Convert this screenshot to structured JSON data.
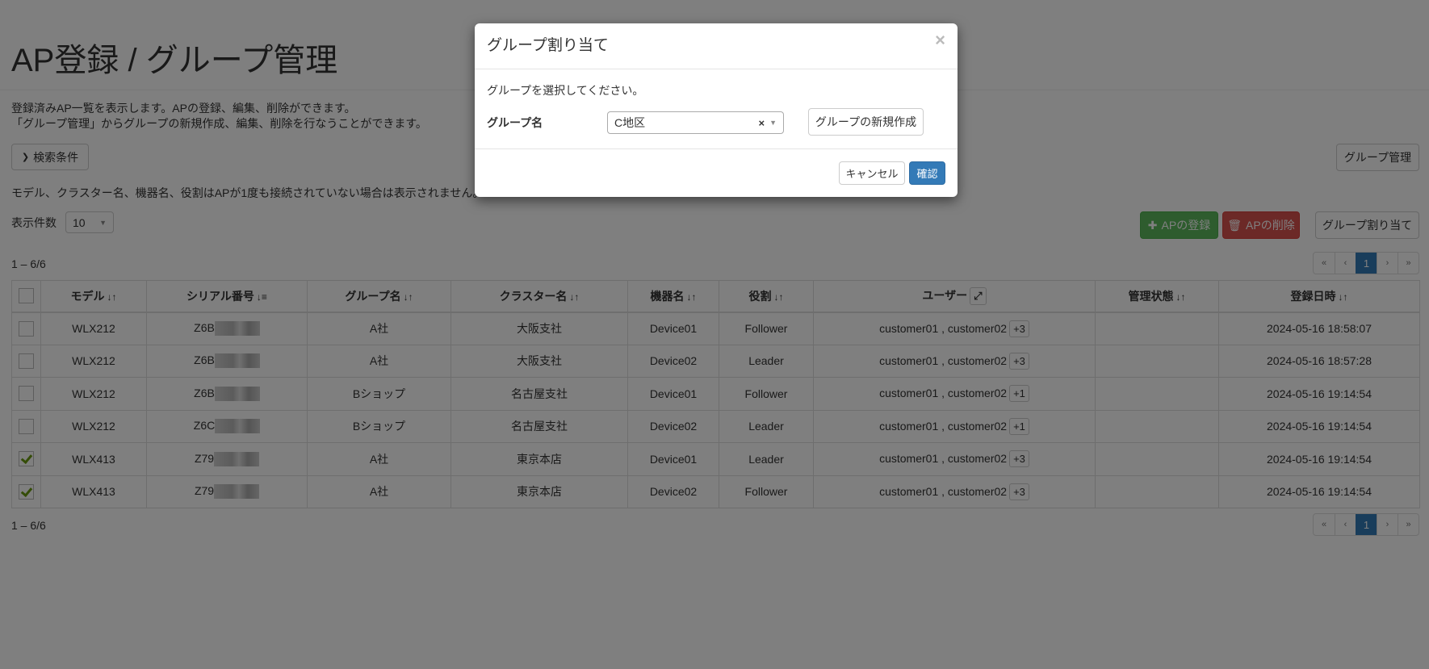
{
  "page": {
    "title": "AP登録 / グループ管理",
    "description_1": "登録済みAP一覧を表示します。APの登録、編集、削除ができます。",
    "description_2": "「グループ管理」からグループの新規作成、編集、削除を行なうことができます。",
    "search_conditions": "検索条件",
    "group_management": "グループ管理",
    "note": "モデル、クラスター名、機器名、役割はAPが1度も接続されていない場合は表示されません。",
    "page_size_label": "表示件数",
    "page_size": "10",
    "register_ap": "APの登録",
    "delete_ap": "APの削除",
    "assign_group": "グループ割り当て",
    "count_top": "1 – 6/6",
    "count_bottom": "1 – 6/6"
  },
  "pagination": {
    "first": "«",
    "prev": "‹",
    "current": "1",
    "next": "›",
    "last": "»"
  },
  "table": {
    "columns": [
      "モデル",
      "シリアル番号",
      "グループ名",
      "クラスター名",
      "機器名",
      "役割",
      "ユーザー",
      "管理状態",
      "登録日時"
    ],
    "rows": [
      {
        "checked": false,
        "model": "WLX212",
        "serial": "Z6B",
        "group": "A社",
        "cluster": "大阪支社",
        "device": "Device01",
        "role": "Follower",
        "users": "customer01 , customer02",
        "more": "+3",
        "status": "",
        "date": "2024-05-16 18:58:07"
      },
      {
        "checked": false,
        "model": "WLX212",
        "serial": "Z6B",
        "group": "A社",
        "cluster": "大阪支社",
        "device": "Device02",
        "role": "Leader",
        "users": "customer01 , customer02",
        "more": "+3",
        "status": "",
        "date": "2024-05-16 18:57:28"
      },
      {
        "checked": false,
        "model": "WLX212",
        "serial": "Z6B",
        "group": "Bショップ",
        "cluster": "名古屋支社",
        "device": "Device01",
        "role": "Follower",
        "users": "customer01 , customer02",
        "more": "+1",
        "status": "",
        "date": "2024-05-16 19:14:54"
      },
      {
        "checked": false,
        "model": "WLX212",
        "serial": "Z6C",
        "group": "Bショップ",
        "cluster": "名古屋支社",
        "device": "Device02",
        "role": "Leader",
        "users": "customer01 , customer02",
        "more": "+1",
        "status": "",
        "date": "2024-05-16 19:14:54"
      },
      {
        "checked": true,
        "model": "WLX413",
        "serial": "Z79",
        "group": "A社",
        "cluster": "東京本店",
        "device": "Device01",
        "role": "Leader",
        "users": "customer01 , customer02",
        "more": "+3",
        "status": "",
        "date": "2024-05-16 19:14:54"
      },
      {
        "checked": true,
        "model": "WLX413",
        "serial": "Z79",
        "group": "A社",
        "cluster": "東京本店",
        "device": "Device02",
        "role": "Follower",
        "users": "customer01 , customer02",
        "more": "+3",
        "status": "",
        "date": "2024-05-16 19:14:54"
      }
    ]
  },
  "modal": {
    "title": "グループ割り当て",
    "close": "×",
    "prompt": "グループを選択してください。",
    "group_label": "グループ名",
    "group_value": "C地区",
    "clear": "×",
    "new_group": "グループの新規作成",
    "cancel": "キャンセル",
    "confirm": "確認"
  },
  "colors": {
    "primary": "#337ab7",
    "success": "#5cb85c",
    "danger": "#d9534f"
  }
}
